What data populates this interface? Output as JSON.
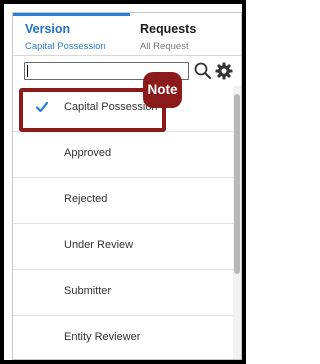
{
  "tabs": [
    {
      "title": "Version",
      "subtitle": "Capital Possession",
      "active": true
    },
    {
      "title": "Requests",
      "subtitle": "All Request",
      "active": false
    }
  ],
  "search": {
    "value": "",
    "placeholder": ""
  },
  "icons": {
    "search": "search-icon",
    "settings": "gear-icon",
    "selected": "checkmark-icon"
  },
  "list": {
    "items": [
      {
        "label": "Capital Possession",
        "selected": true
      },
      {
        "label": "Approved",
        "selected": false
      },
      {
        "label": "Rejected",
        "selected": false
      },
      {
        "label": "Under Review",
        "selected": false
      },
      {
        "label": "Submitter",
        "selected": false
      },
      {
        "label": "Entity Reviewer",
        "selected": false
      }
    ]
  },
  "annotation": {
    "badge": "Note"
  },
  "colors": {
    "accent": "#2a7fd4",
    "annotation": "#8b1a1a",
    "frame": "#000000"
  }
}
